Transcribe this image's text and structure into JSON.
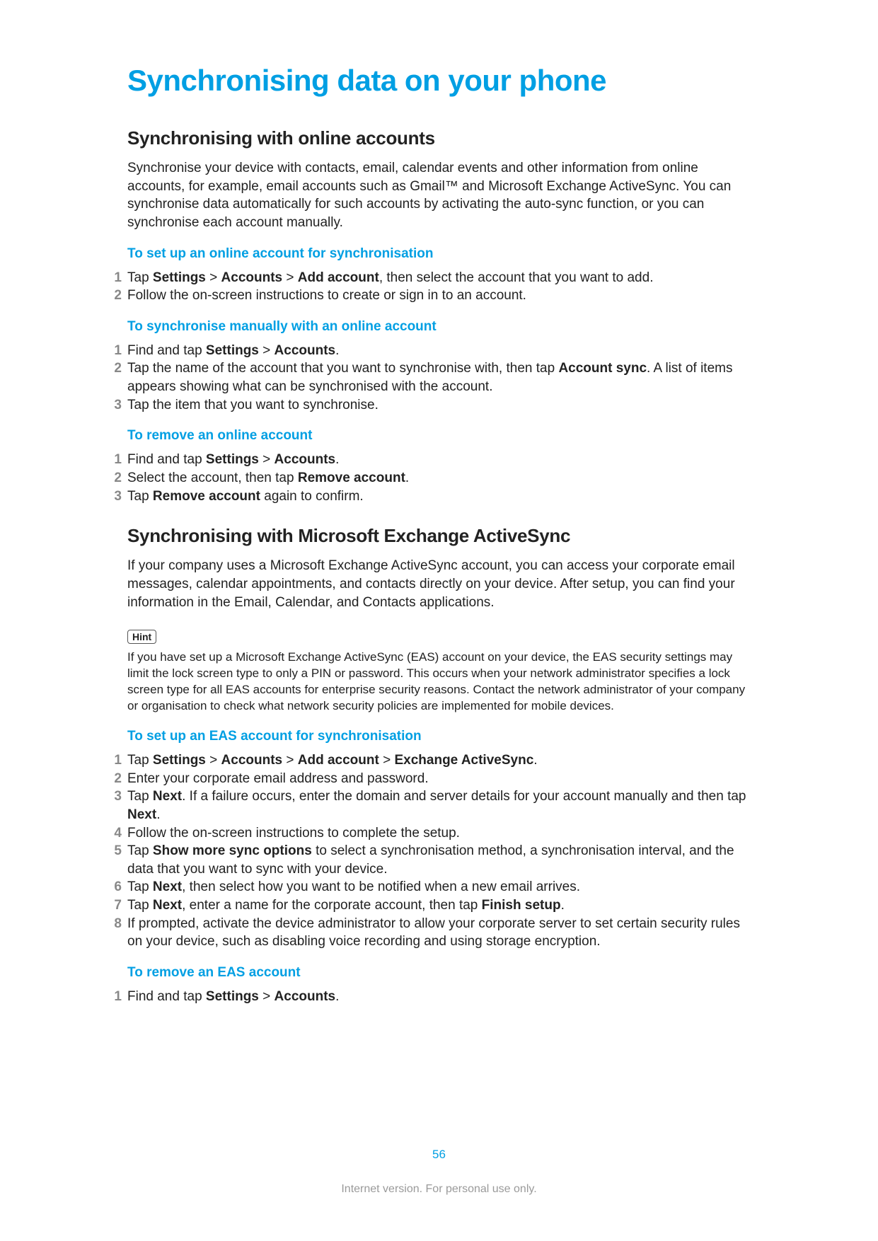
{
  "title": "Synchronising data on your phone",
  "section1": {
    "heading": "Synchronising with online accounts",
    "intro": "Synchronise your device with contacts, email, calendar events and other information from online accounts, for example, email accounts such as Gmail™ and Microsoft Exchange ActiveSync. You can synchronise data automatically for such accounts by activating the auto-sync function, or you can synchronise each account manually.",
    "proc1": {
      "title": "To set up an online account for synchronisation",
      "steps": [
        "Tap <b>Settings</b> > <b>Accounts</b> > <b>Add account</b>, then select the account that you want to add.",
        "Follow the on-screen instructions to create or sign in to an account."
      ]
    },
    "proc2": {
      "title": "To synchronise manually with an online account",
      "steps": [
        "Find and tap <b>Settings</b> > <b>Accounts</b>.",
        "Tap the name of the account that you want to synchronise with, then tap <b>Account sync</b>. A list of items appears showing what can be synchronised with the account.",
        "Tap the item that you want to synchronise."
      ]
    },
    "proc3": {
      "title": "To remove an online account",
      "steps": [
        "Find and tap <b>Settings</b> > <b>Accounts</b>.",
        "Select the account, then tap <b>Remove account</b>.",
        "Tap <b>Remove account</b> again to confirm."
      ]
    }
  },
  "section2": {
    "heading": "Synchronising with Microsoft Exchange ActiveSync",
    "intro": "If your company uses a Microsoft Exchange ActiveSync account, you can access your corporate email messages, calendar appointments, and contacts directly on your device. After setup, you can find your information in the Email, Calendar, and Contacts applications.",
    "hint_label": "Hint",
    "hint_body": "If you have set up a Microsoft Exchange ActiveSync (EAS) account on your device, the EAS security settings may limit the lock screen type to only a PIN or password. This occurs when your network administrator specifies a lock screen type for all EAS accounts for enterprise security reasons. Contact the network administrator of your company or organisation to check what network security policies are implemented for mobile devices.",
    "proc1": {
      "title": "To set up an EAS account for synchronisation",
      "steps": [
        "Tap <b>Settings</b> > <b>Accounts</b> > <b>Add account</b> > <b>Exchange ActiveSync</b>.",
        "Enter your corporate email address and password.",
        "Tap <b>Next</b>. If a failure occurs, enter the domain and server details for your account manually and then tap <b>Next</b>.",
        "Follow the on-screen instructions to complete the setup.",
        "Tap <b>Show more sync options</b> to select a synchronisation method, a synchronisation interval, and the data that you want to sync with your device.",
        "Tap <b>Next</b>, then select how you want to be notified when a new email arrives.",
        "Tap <b>Next</b>, enter a name for the corporate account, then tap <b>Finish setup</b>.",
        "If prompted, activate the device administrator to allow your corporate server to set certain security rules on your device, such as disabling voice recording and using storage encryption."
      ]
    },
    "proc2": {
      "title": "To remove an EAS account",
      "steps": [
        "Find and tap <b>Settings</b> > <b>Accounts</b>."
      ]
    }
  },
  "page_number": "56",
  "footer": "Internet version. For personal use only."
}
